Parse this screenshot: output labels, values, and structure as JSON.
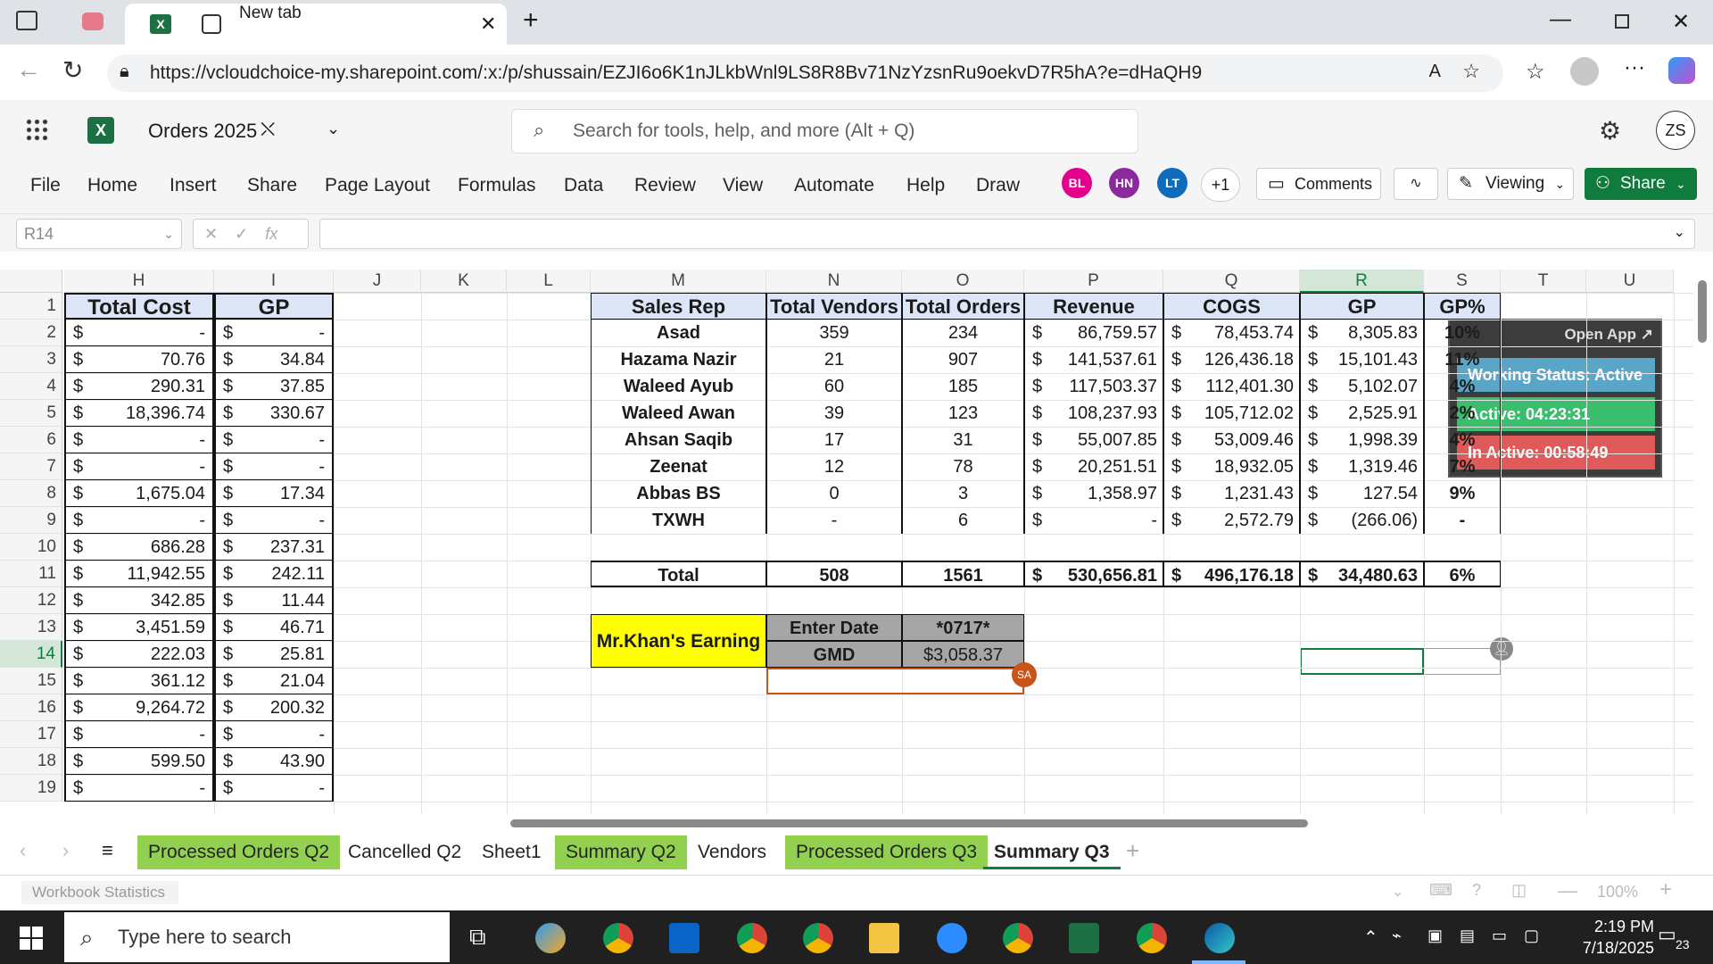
{
  "browser": {
    "tabs": [
      {
        "label": "New tab"
      }
    ],
    "url": "https://vcloudchoice-my.sharepoint.com/:x:/p/shussain/EZJI6o6K1nJLkbWnl9LS8R8Bv71NzYzsnRu9oekvD7R5hA?e=dHaQH9"
  },
  "excel": {
    "doc_title": "Orders 2025",
    "search_placeholder": "Search for tools, help, and more (Alt + Q)",
    "user_initials": "ZS",
    "ribbon_tabs": [
      "File",
      "Home",
      "Insert",
      "Share",
      "Page Layout",
      "Formulas",
      "Data",
      "Review",
      "View",
      "Automate",
      "Help",
      "Draw"
    ],
    "collaborators": [
      {
        "initials": "BL",
        "color": "#e3008c"
      },
      {
        "initials": "HN",
        "color": "#8a2a9e"
      },
      {
        "initials": "LT",
        "color": "#0f6cbd"
      }
    ],
    "more_collab": "+1",
    "comments_label": "Comments",
    "viewing_label": "Viewing",
    "share_label": "Share",
    "name_box": "R14",
    "fx_label": "fx"
  },
  "grid": {
    "columns": [
      "H",
      "I",
      "J",
      "K",
      "L",
      "M",
      "N",
      "O",
      "P",
      "Q",
      "R",
      "S",
      "T",
      "U"
    ],
    "rows": [
      "1",
      "2",
      "3",
      "4",
      "5",
      "6",
      "7",
      "8",
      "9",
      "10",
      "11",
      "12",
      "13",
      "14",
      "15",
      "16",
      "17",
      "18",
      "19"
    ],
    "left_table": {
      "headers": [
        "Total Cost",
        "GP"
      ],
      "currency": "$",
      "values": [
        [
          "-",
          "-"
        ],
        [
          "70.76",
          "34.84"
        ],
        [
          "290.31",
          "37.85"
        ],
        [
          "18,396.74",
          "330.67"
        ],
        [
          "-",
          "-"
        ],
        [
          "-",
          "-"
        ],
        [
          "1,675.04",
          "17.34"
        ],
        [
          "-",
          "-"
        ],
        [
          "686.28",
          "237.31"
        ],
        [
          "11,942.55",
          "242.11"
        ],
        [
          "342.85",
          "11.44"
        ],
        [
          "3,451.59",
          "46.71"
        ],
        [
          "222.03",
          "25.81"
        ],
        [
          "361.12",
          "21.04"
        ],
        [
          "9,264.72",
          "200.32"
        ],
        [
          "-",
          "-"
        ],
        [
          "599.50",
          "43.90"
        ],
        [
          "-",
          "-"
        ]
      ]
    },
    "summary_table": {
      "headers": [
        "Sales Rep",
        "Total Vendors",
        "Total Orders",
        "Revenue",
        "COGS",
        "GP",
        "GP%"
      ],
      "rows": [
        [
          "Asad",
          "359",
          "234",
          "86,759.57",
          "78,453.74",
          "8,305.83",
          "10%"
        ],
        [
          "Hazama Nazir",
          "21",
          "907",
          "141,537.61",
          "126,436.18",
          "15,101.43",
          "11%"
        ],
        [
          "Waleed Ayub",
          "60",
          "185",
          "117,503.37",
          "112,401.30",
          "5,102.07",
          "4%"
        ],
        [
          "Waleed Awan",
          "39",
          "123",
          "108,237.93",
          "105,712.02",
          "2,525.91",
          "2%"
        ],
        [
          "Ahsan Saqib",
          "17",
          "31",
          "55,007.85",
          "53,009.46",
          "1,998.39",
          "4%"
        ],
        [
          "Zeenat",
          "12",
          "78",
          "20,251.51",
          "18,932.05",
          "1,319.46",
          "7%"
        ],
        [
          "Abbas BS",
          "0",
          "3",
          "1,358.97",
          "1,231.43",
          "127.54",
          "9%"
        ],
        [
          "TXWH",
          "-",
          "6",
          "-",
          "2,572.79",
          "(266.06)",
          "-"
        ]
      ],
      "total": [
        "Total",
        "508",
        "1561",
        "530,656.81",
        "496,176.18",
        "34,480.63",
        "6%"
      ]
    },
    "earning_box": {
      "label": "Mr.Khan's Earning",
      "enter_date_label": "Enter Date",
      "enter_date_value": "*0717*",
      "gmd_label": "GMD",
      "gmd_value": "$3,058.37",
      "cursor_tag": "SA"
    }
  },
  "overlay": {
    "open_app": "Open App ↗",
    "working_status": "Working Status: Active",
    "active": "Active: 04:23:31",
    "inactive": "In Active: 00:58:49"
  },
  "sheet_tabs": [
    {
      "label": "Processed Orders Q2",
      "green": true
    },
    {
      "label": "Cancelled Q2",
      "green": false
    },
    {
      "label": "Sheet1",
      "green": false
    },
    {
      "label": "Summary Q2",
      "green": true
    },
    {
      "label": "Vendors",
      "green": false
    },
    {
      "label": "Processed Orders Q3",
      "green": true
    },
    {
      "label": "Summary Q3",
      "green": false,
      "active": true
    }
  ],
  "status_bar": {
    "left": "Workbook Statistics",
    "zoom": "100%"
  },
  "taskbar": {
    "search_placeholder": "Type here to search",
    "time": "2:19 PM",
    "date": "7/18/2025",
    "notif_count": "23"
  }
}
